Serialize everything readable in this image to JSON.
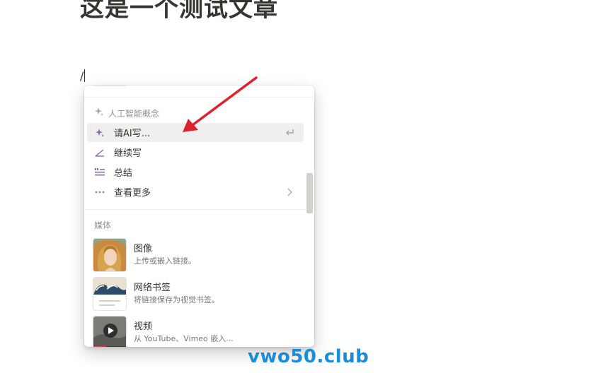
{
  "page": {
    "title": "这是一个测试文章",
    "editor_input": "/"
  },
  "slash_menu": {
    "ai_section_label": "人工智能概念",
    "ai_items": [
      {
        "label": "请AI写...",
        "icon": "sparkle-icon",
        "right_icon": "enter-icon",
        "selected": true
      },
      {
        "label": "继续写",
        "icon": "angle-pen-icon"
      },
      {
        "label": "总结",
        "icon": "summary-lines-icon"
      },
      {
        "label": "查看更多",
        "icon": "more-dots-icon",
        "right_icon": "chevron-right-icon"
      }
    ],
    "media_section_label": "媒体",
    "media_items": [
      {
        "title": "图像",
        "description": "上传或嵌入链接。",
        "thumbnail": "portrait-painting-thumbnail"
      },
      {
        "title": "网络书签",
        "description": "将链接保存为视觉书签。",
        "thumbnail": "wave-painting-bookmark-thumbnail"
      },
      {
        "title": "视频",
        "description": "从 YouTube、Vimeo 嵌入...",
        "thumbnail": "video-play-thumbnail"
      }
    ]
  },
  "watermark": "vwo50.club",
  "colors": {
    "accent_purple": "#9065b0",
    "selected_bg": "#efefee",
    "annotation_arrow": "#e0202b",
    "watermark": "#1a8cd8"
  }
}
